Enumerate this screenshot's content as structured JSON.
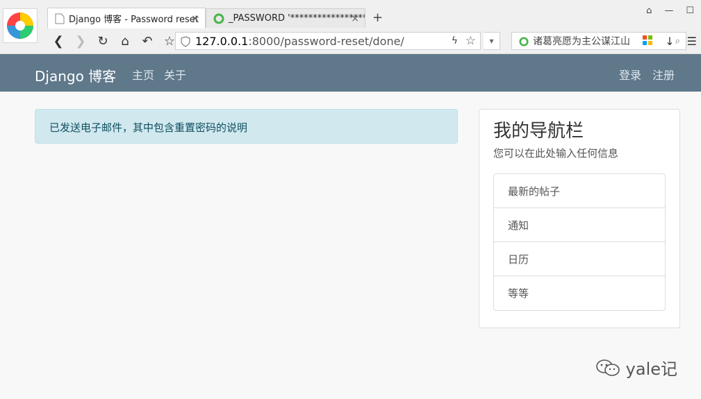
{
  "browser": {
    "tabs": [
      {
        "title": "Django 博客 - Password reset",
        "close": "×"
      },
      {
        "title": "_PASSWORD '********************",
        "close": "×"
      }
    ],
    "add_tab": "+",
    "window_controls": [
      "restore-icon",
      "minimize-icon",
      "maximize-icon"
    ],
    "url_host": "127.0.0.1",
    "url_rest": ":8000/password-reset/done/",
    "search_text": "诸葛亮愿为主公谋江山"
  },
  "navbar": {
    "brand": "Django 博客",
    "left_links": [
      "主页",
      "关于"
    ],
    "right_links": [
      "登录",
      "注册"
    ],
    "bg_color": "#5f788a"
  },
  "alert": {
    "message": "已发送电子邮件，其中包含重置密码的说明",
    "bg_color": "#d1e8ef"
  },
  "sidebar": {
    "title": "我的导航栏",
    "subtitle": "您可以在此处输入任何信息",
    "items": [
      "最新的帖子",
      "通知",
      "日历",
      "等等"
    ]
  },
  "watermark": {
    "text": "yale记"
  }
}
